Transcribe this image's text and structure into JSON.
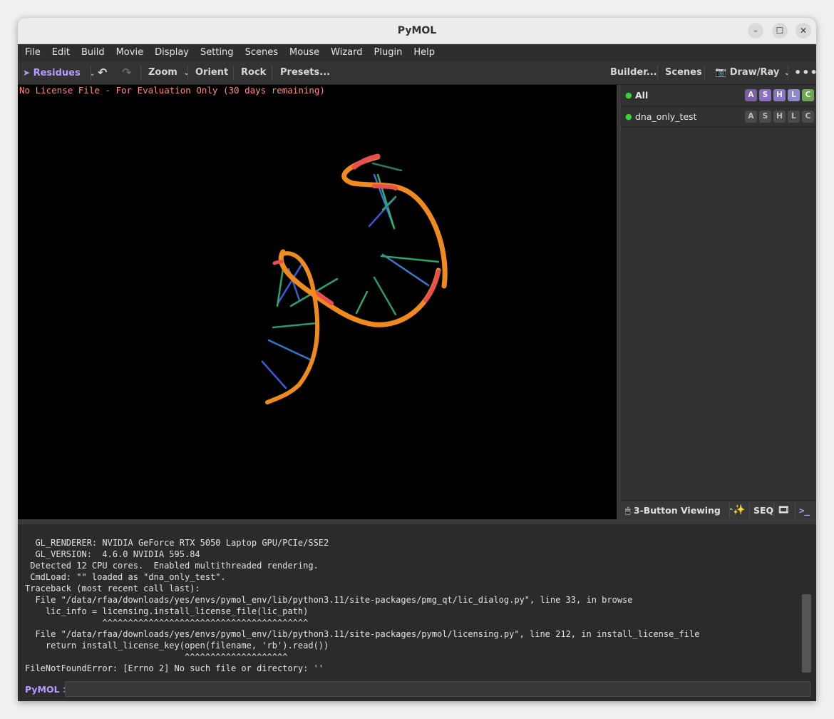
{
  "window": {
    "title": "PyMOL"
  },
  "menubar": [
    "File",
    "Edit",
    "Build",
    "Movie",
    "Display",
    "Setting",
    "Scenes",
    "Mouse",
    "Wizard",
    "Plugin",
    "Help"
  ],
  "toolbar": {
    "mode": "Residues",
    "zoom": "Zoom",
    "orient": "Orient",
    "rock": "Rock",
    "presets": "Presets...",
    "builder": "Builder...",
    "scenes": "Scenes",
    "draw_ray": "Draw/Ray"
  },
  "viewport": {
    "license_text": "No License File - For Evaluation Only (30 days remaining)"
  },
  "objects": [
    {
      "name": "All",
      "buttons": [
        "A",
        "S",
        "H",
        "L",
        "C"
      ],
      "active": true
    },
    {
      "name": "dna_only_test",
      "buttons": [
        "A",
        "S",
        "H",
        "L",
        "C"
      ],
      "active": false
    }
  ],
  "panel_bottom": {
    "viewing_mode": "3-Button Viewing",
    "seq": "SEQ"
  },
  "console": {
    "lines": [
      "  GL_RENDERER: NVIDIA GeForce RTX 5050 Laptop GPU/PCIe/SSE2",
      "  GL_VERSION:  4.6.0 NVIDIA 595.84",
      " Detected 12 CPU cores.  Enabled multithreaded rendering.",
      " CmdLoad: \"\" loaded as \"dna_only_test\".",
      "Traceback (most recent call last):",
      "  File \"/data/rfaa/downloads/yes/envs/pymol_env/lib/python3.11/site-packages/pmg_qt/lic_dialog.py\", line 33, in browse",
      "    lic_info = licensing.install_license_file(lic_path)",
      "               ^^^^^^^^^^^^^^^^^^^^^^^^^^^^^^^^^^^^^^^^",
      "  File \"/data/rfaa/downloads/yes/envs/pymol_env/lib/python3.11/site-packages/pymol/licensing.py\", line 212, in install_license_file",
      "    return install_license_key(open(filename, 'rb').read())",
      "                               ^^^^^^^^^^^^^^^^^^^^",
      "FileNotFoundError: [Errno 2] No such file or directory: ''"
    ],
    "prompt": "PyMOL >",
    "input_value": ""
  },
  "colors": {
    "accent": "#b79cff",
    "license_text": "#ff8a8a",
    "backbone": "#f08a1c",
    "backbone_tip": "#e85050",
    "A": "#7a5ea8",
    "S": "#8c6fc4",
    "H": "#8a76c8",
    "L": "#8a8ad0",
    "C": "#6aa84f"
  }
}
